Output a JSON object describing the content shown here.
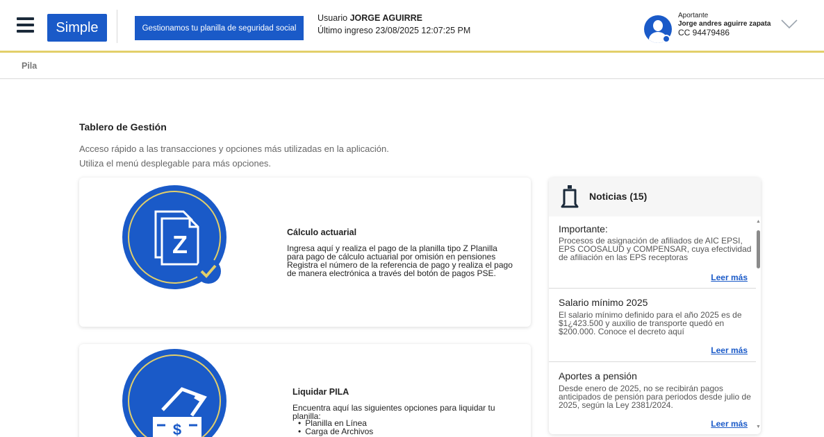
{
  "header": {
    "logo_text": "Simple",
    "tagline": "Gestionamos tu planilla de seguridad social",
    "user_prefix": "Usuario",
    "user_name": "JORGE AGUIRRE",
    "last_login": "Último ingreso 23/08/2025 12:07:25 PM",
    "role": "Aportante",
    "account_name": "Jorge andres aguirre zapata",
    "document": "CC 94479486",
    "accent_color": "#1a5ac8",
    "rule_color": "#e2cf6a"
  },
  "breadcrumb": "Pila",
  "main": {
    "title": "Tablero de Gestión",
    "subtitle_1": "Acceso rápido a las transacciones y opciones más utilizadas en la aplicación.",
    "subtitle_2": "Utiliza el menú desplegable para más opciones.",
    "cards": [
      {
        "title": "Cálculo actuarial",
        "description": "Ingresa aquí y realiza el pago de la planilla tipo Z Planilla para pago de cálculo actuarial por omisión en pensiones Registra el número de la referencia de pago y realiza el pago de manera electrónica a través del botón de pagos PSE.",
        "icon_letter": "Z",
        "icon": "document-z-icon"
      },
      {
        "title": "Liquidar PILA",
        "description": "Encuentra aquí las siguientes opciones para liquidar tu planilla:",
        "options": [
          "Planilla en Línea",
          "Carga de Archivos"
        ],
        "icon": "payment-icon"
      }
    ]
  },
  "news": {
    "title": "Noticias (15)",
    "items": [
      {
        "title": "Importante:",
        "text": "Procesos de asignación de afiliados de AIC EPSI, EPS COOSALUD y COMPENSAR, cuya efectividad de afiliación en las EPS receptoras",
        "link": "Leer más"
      },
      {
        "title": "Salario mínimo 2025",
        "text": "El salario mínimo definido para el año 2025 es de $1¿423.500 y auxilio de transporte quedó en $200.000. Conoce el decreto aquí",
        "link": "Leer más"
      },
      {
        "title": "Aportes a pensión",
        "text": "Desde enero de 2025, no se recibirán pagos anticipados de pensión para periodos desde julio de 2025, según la Ley 2381/2024.",
        "link": "Leer más"
      }
    ]
  }
}
